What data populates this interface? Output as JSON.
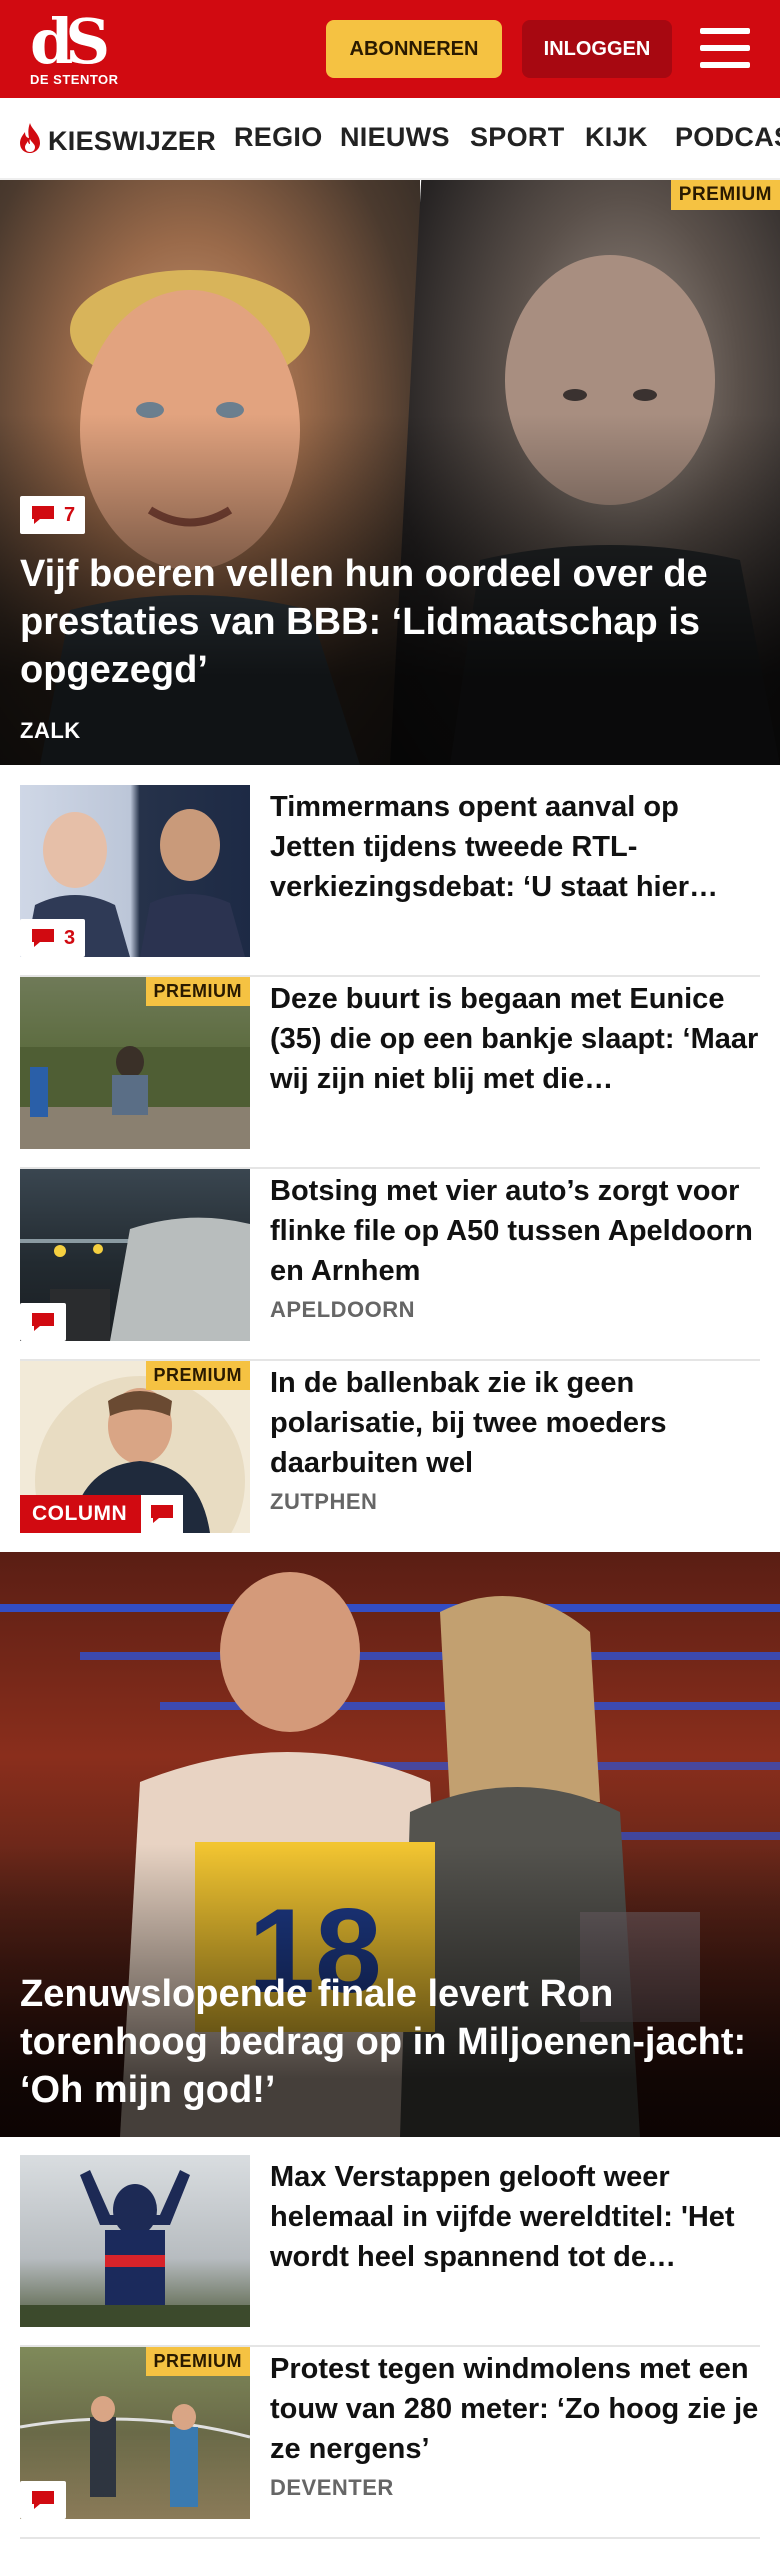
{
  "header": {
    "logo_mark": "dS",
    "logo_sub": "DE STENTOR",
    "subscribe_label": "ABONNEREN",
    "login_label": "INLOGGEN"
  },
  "nav": {
    "items": [
      "KIESWIJZER",
      "REGIO",
      "NIEUWS",
      "SPORT",
      "KIJK",
      "PODCAS"
    ]
  },
  "hero": {
    "premium": "PREMIUM",
    "comments": "7",
    "title": "Vijf boeren vellen hun oordeel over de prestaties van BBB: ‘Lidmaatschap is opgezegd’",
    "location": "ZALK"
  },
  "articles": [
    {
      "title": "Timmermans opent aanval op Jetten tijdens tweede RTL-verkiezingsdebat: ‘U staat hier…",
      "comments": "3",
      "location": "",
      "premium": "",
      "column": ""
    },
    {
      "title": "Deze buurt is begaan met Eunice (35) die op een bankje slaapt: ‘Maar wij zijn niet blij met die…",
      "comments": "",
      "location": "",
      "premium": "PREMIUM",
      "column": ""
    },
    {
      "title": "Botsing met vier auto’s zorgt voor flinke file op A50 tussen Apeldoorn en Arnhem",
      "comments": "",
      "location": "APELDOORN",
      "premium": "",
      "column": ""
    },
    {
      "title": "In de ballenbak zie ik geen polarisatie, bij twee moeders daarbuiten wel",
      "comments": "",
      "location": "ZUTPHEN",
      "premium": "PREMIUM",
      "column": "COLUMN"
    }
  ],
  "feature": {
    "title": "Zenuwslopende finale levert Ron torenhoog bedrag op in Miljoenen-jacht: ‘Oh mijn god!’",
    "box_number": "18"
  },
  "articles2": [
    {
      "title": "Max Verstappen gelooft weer helemaal in vijfde wereldtitel: 'Het wordt heel spannend tot de…",
      "location": "",
      "premium": ""
    },
    {
      "title": "Protest tegen windmolens met een touw van 280 meter: ‘Zo hoog zie je ze nergens’",
      "location": "DEVENTER",
      "premium": "PREMIUM"
    }
  ],
  "colors": {
    "brand_red": "#d10a11",
    "premium_yellow": "#f5c242",
    "login_dark_red": "#a70811"
  },
  "icons": {
    "menu": "hamburger-menu-icon",
    "comment": "comment-icon",
    "flame": "flame-icon"
  }
}
